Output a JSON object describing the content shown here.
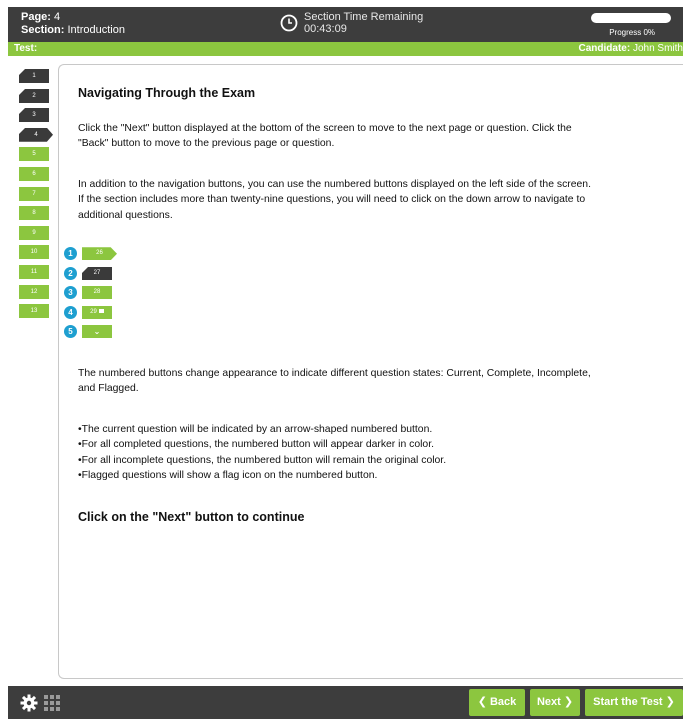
{
  "header": {
    "page_label": "Page:",
    "page_value": "4",
    "section_label": "Section:",
    "section_value": "Introduction",
    "timer_label": "Section Time Remaining",
    "timer_value": "00:43:09",
    "progress_label": "Progress 0%",
    "progress_fraction": 0
  },
  "infobar": {
    "test_label": "Test:",
    "candidate_label": "Candidate:",
    "candidate_value": "John Smith"
  },
  "sidenav": {
    "items": [
      {
        "label": "1",
        "state": "done"
      },
      {
        "label": "2",
        "state": "done"
      },
      {
        "label": "3",
        "state": "done"
      },
      {
        "label": "4",
        "state": "current"
      },
      {
        "label": "5",
        "state": "open"
      },
      {
        "label": "6",
        "state": "open"
      },
      {
        "label": "7",
        "state": "open"
      },
      {
        "label": "8",
        "state": "open"
      },
      {
        "label": "9",
        "state": "open"
      },
      {
        "label": "10",
        "state": "open"
      },
      {
        "label": "11",
        "state": "open"
      },
      {
        "label": "12",
        "state": "open"
      },
      {
        "label": "13",
        "state": "open"
      }
    ]
  },
  "content": {
    "title": "Navigating Through the Exam",
    "para1": "Click the \"Next\" button displayed at the bottom of the screen to move to the next page or question. Click the \"Back\" button to move to the previous page or question.",
    "para2": "In addition to the navigation buttons, you can use the numbered buttons displayed on the left side of the screen. If the section includes more than twenty-nine questions, you will need to click on the down arrow to navigate to additional questions.",
    "examples": [
      {
        "num": "1",
        "label": "26"
      },
      {
        "num": "2",
        "label": "27"
      },
      {
        "num": "3",
        "label": "28"
      },
      {
        "num": "4",
        "label": "29"
      },
      {
        "num": "5",
        "label": "⌄"
      }
    ],
    "para3": "The numbered buttons change appearance to indicate different question states: Current, Complete, Incomplete, and Flagged.",
    "bullets": [
      "The current question will be indicated by an arrow-shaped numbered button.",
      "For all completed questions, the numbered button will appear darker in color.",
      "For all incomplete questions, the numbered button will remain the original color.",
      "Flagged questions will show a flag icon on the numbered button."
    ],
    "cta": "Click on the \"Next\" button to continue"
  },
  "footer": {
    "back_label": "❮ Back",
    "next_label": "Next ❯",
    "start_label": "Start the Test ❯"
  },
  "colors": {
    "accent": "#8cc63f",
    "dark": "#3d3d3d",
    "badge": "#1e9fd0"
  }
}
